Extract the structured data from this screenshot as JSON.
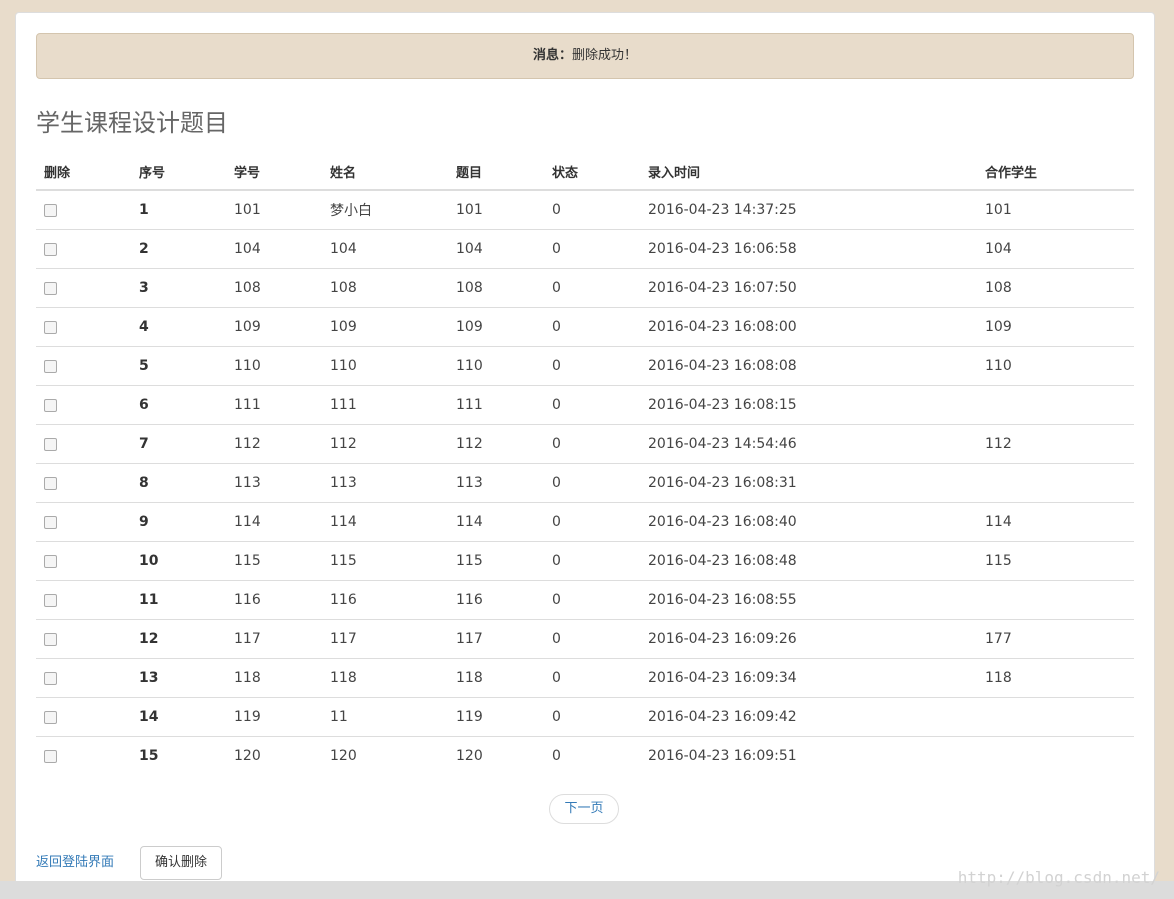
{
  "alert": {
    "label": "消息：",
    "text": "删除成功！"
  },
  "page_title": "学生课程设计题目",
  "table": {
    "headers": [
      "删除",
      "序号",
      "学号",
      "姓名",
      "题目",
      "状态",
      "录入时间",
      "合作学生"
    ],
    "rows": [
      [
        "1",
        "101",
        "梦小白",
        "101",
        "0",
        "2016-04-23 14:37:25",
        "101"
      ],
      [
        "2",
        "104",
        "104",
        "104",
        "0",
        "2016-04-23 16:06:58",
        "104"
      ],
      [
        "3",
        "108",
        "108",
        "108",
        "0",
        "2016-04-23 16:07:50",
        "108"
      ],
      [
        "4",
        "109",
        "109",
        "109",
        "0",
        "2016-04-23 16:08:00",
        "109"
      ],
      [
        "5",
        "110",
        "110",
        "110",
        "0",
        "2016-04-23 16:08:08",
        "110"
      ],
      [
        "6",
        "111",
        "111",
        "111",
        "0",
        "2016-04-23 16:08:15",
        ""
      ],
      [
        "7",
        "112",
        "112",
        "112",
        "0",
        "2016-04-23 14:54:46",
        "112"
      ],
      [
        "8",
        "113",
        "113",
        "113",
        "0",
        "2016-04-23 16:08:31",
        ""
      ],
      [
        "9",
        "114",
        "114",
        "114",
        "0",
        "2016-04-23 16:08:40",
        "114"
      ],
      [
        "10",
        "115",
        "115",
        "115",
        "0",
        "2016-04-23 16:08:48",
        "115"
      ],
      [
        "11",
        "116",
        "116",
        "116",
        "0",
        "2016-04-23 16:08:55",
        ""
      ],
      [
        "12",
        "117",
        "117",
        "117",
        "0",
        "2016-04-23 16:09:26",
        "177"
      ],
      [
        "13",
        "118",
        "118",
        "118",
        "0",
        "2016-04-23 16:09:34",
        "118"
      ],
      [
        "14",
        "119",
        "11",
        "119",
        "0",
        "2016-04-23 16:09:42",
        ""
      ],
      [
        "15",
        "120",
        "120",
        "120",
        "0",
        "2016-04-23 16:09:51",
        ""
      ]
    ]
  },
  "pagination": {
    "next_label": "下一页"
  },
  "footer": {
    "back_link": "返回登陆界面",
    "confirm_button": "确认删除"
  },
  "watermark": "http://blog.csdn.net/"
}
